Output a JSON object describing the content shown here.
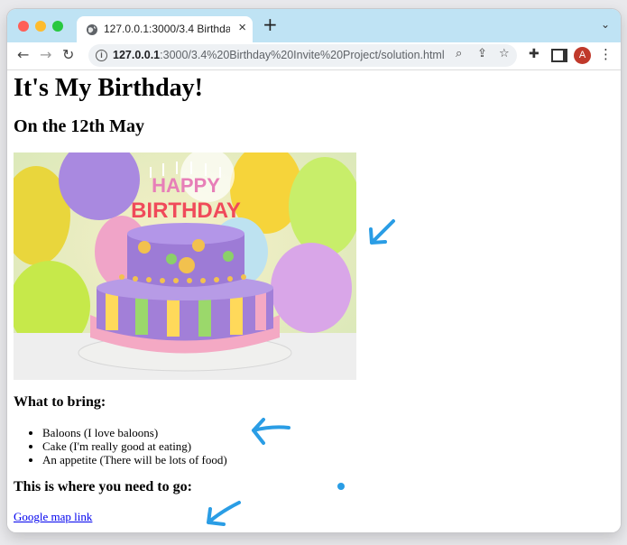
{
  "browser": {
    "tab_title": "127.0.0.1:3000/3.4 Birthday Invite Project/solution.html",
    "url_host": "127.0.0.1",
    "url_path": ":3000/3.4%20Birthday%20Invite%20Project/solution.html",
    "profile_initial": "A",
    "accent_color": "#bfe3f4"
  },
  "page": {
    "heading": "It's My Birthday!",
    "date_heading": "On the 12th May",
    "bring_heading": "What to bring:",
    "bring_items": [
      "Baloons (I love baloons)",
      "Cake (I'm really good at eating)",
      "An appetite (There will be lots of food)"
    ],
    "location_heading": "This is where you need to go:",
    "map_link_label": "Google map link",
    "cake_topper_text": "HAPPY BIRTHDAY"
  },
  "annotations": {
    "color": "#2a9de5",
    "icons": [
      "arrow-down-left-icon",
      "arrow-left-icon",
      "dot-icon",
      "arrow-down-left-icon"
    ]
  }
}
